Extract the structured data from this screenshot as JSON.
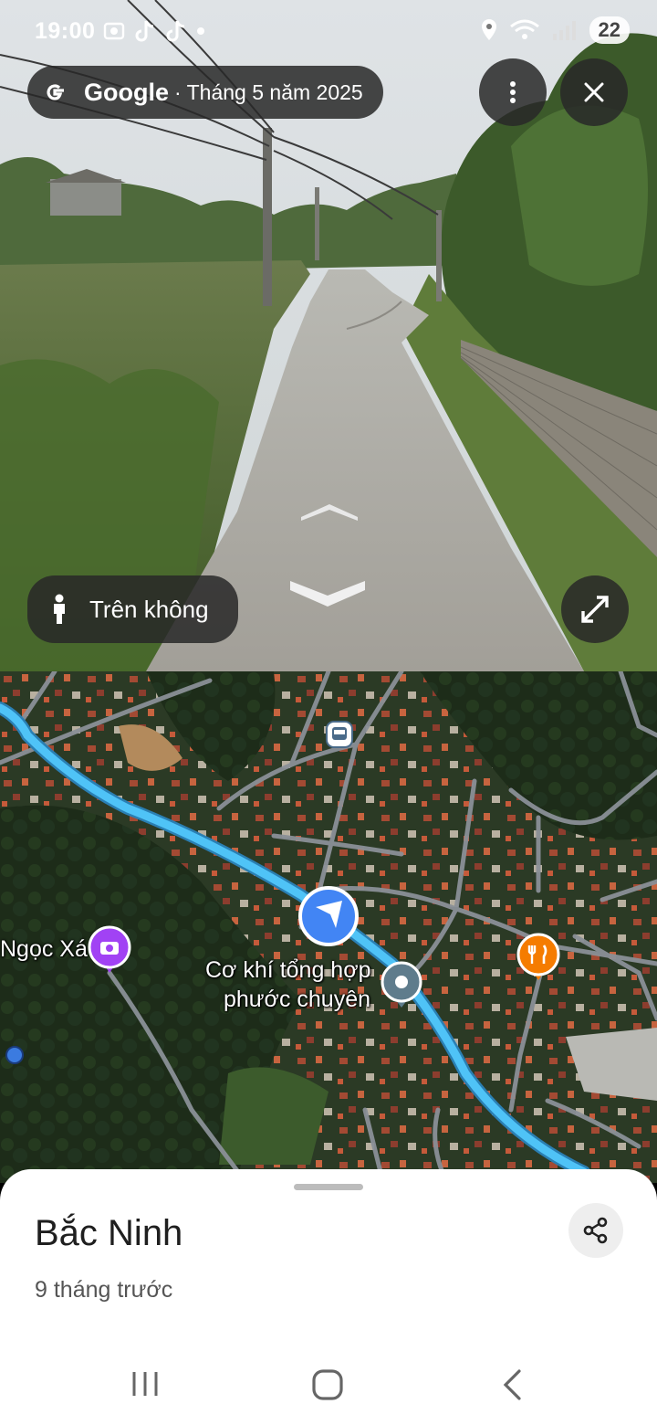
{
  "status_bar": {
    "time": "19:00",
    "battery": "22"
  },
  "street_view": {
    "brand": "Google",
    "date": "· Tháng 5 năm 2025",
    "aerial_label": "Trên không"
  },
  "map": {
    "labels": {
      "ngoc_xa": "Ngọc Xá",
      "business_line1": "Cơ khí tổng hợp",
      "business_line2": "phước chuyên"
    },
    "colors": {
      "route": "#4fc3f7",
      "location": "#4285f4",
      "photo_pin": "#a142f4",
      "food_pin": "#f57c00",
      "business_pin": "#5f7c8c"
    }
  },
  "place": {
    "title": "Bắc Ninh",
    "subtitle": "9 tháng trước"
  },
  "icons": [
    "g-logo-icon",
    "more-vert-icon",
    "close-icon",
    "pegman-icon",
    "expand-icon",
    "chevron-up-icon",
    "chevron-down-icon",
    "bus-stop-icon",
    "camera-pin-icon",
    "restaurant-pin-icon",
    "share-icon",
    "recents-icon",
    "home-icon",
    "back-icon"
  ]
}
